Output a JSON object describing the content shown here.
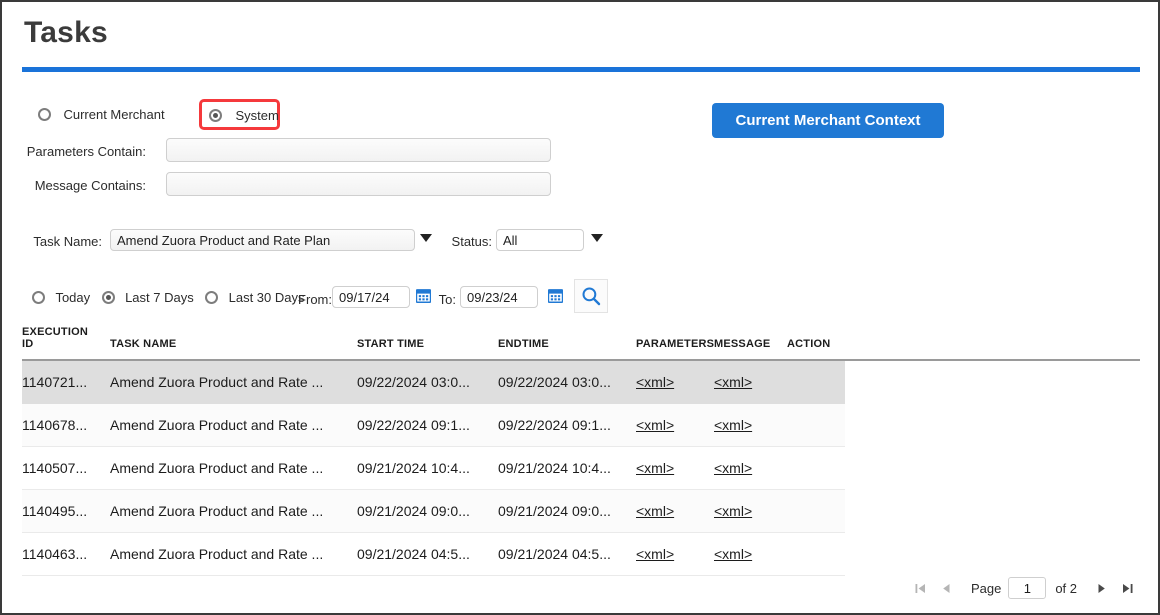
{
  "page": {
    "title": "Tasks"
  },
  "context": {
    "options": [
      {
        "label": "Current Merchant",
        "selected": false
      },
      {
        "label": "System",
        "selected": true,
        "highlighted": true
      }
    ],
    "highlight_color": "#f5393c"
  },
  "filters": {
    "parameters_label": "Parameters Contain:",
    "parameters_value": "",
    "message_label": "Message Contains:",
    "message_value": "",
    "task_name_label": "Task Name:",
    "task_name_value": "Amend Zuora Product and Rate Plan",
    "status_label": "Status:",
    "status_value": "All"
  },
  "date_filter": {
    "options": [
      {
        "label": "Today",
        "selected": false
      },
      {
        "label": "Last 7 Days",
        "selected": true
      },
      {
        "label": "Last 30 Days",
        "selected": false
      }
    ],
    "from_label": "From:",
    "from_value": "09/17/24",
    "to_label": "To:",
    "to_value": "09/23/24",
    "from_calendar_icon": "calendar-icon",
    "to_calendar_icon": "calendar-icon",
    "search_icon": "search-icon"
  },
  "actions": {
    "merchant_context_button": "Current Merchant Context",
    "merchant_context_color": "#2079d4"
  },
  "table": {
    "columns": [
      "EXECUTION ID",
      "TASK NAME",
      "START TIME",
      "ENDTIME",
      "PARAMETERS",
      "MESSAGE",
      "ACTION"
    ],
    "rows": [
      {
        "execution_id": "1140721...",
        "task_name": "Amend Zuora Product and Rate ...",
        "start_time": "09/22/2024 03:0...",
        "end_time": "09/22/2024 03:0...",
        "parameters": "<xml>",
        "message": "<xml>",
        "action": "",
        "selected": true
      },
      {
        "execution_id": "1140678...",
        "task_name": "Amend Zuora Product and Rate ...",
        "start_time": "09/22/2024 09:1...",
        "end_time": "09/22/2024 09:1...",
        "parameters": "<xml>",
        "message": "<xml>",
        "action": "",
        "selected": false
      },
      {
        "execution_id": "1140507...",
        "task_name": "Amend Zuora Product and Rate ...",
        "start_time": "09/21/2024 10:4...",
        "end_time": "09/21/2024 10:4...",
        "parameters": "<xml>",
        "message": "<xml>",
        "action": "",
        "selected": false
      },
      {
        "execution_id": "1140495...",
        "task_name": "Amend Zuora Product and Rate ...",
        "start_time": "09/21/2024 09:0...",
        "end_time": "09/21/2024 09:0...",
        "parameters": "<xml>",
        "message": "<xml>",
        "action": "",
        "selected": false
      },
      {
        "execution_id": "1140463...",
        "task_name": "Amend Zuora Product and Rate ...",
        "start_time": "09/21/2024 04:5...",
        "end_time": "09/21/2024 04:5...",
        "parameters": "<xml>",
        "message": "<xml>",
        "action": "",
        "selected": false
      }
    ]
  },
  "pagination": {
    "first_icon": "first-page-icon",
    "prev_icon": "previous-page-icon",
    "page_word": "Page",
    "page_value": "1",
    "of_text": "of 2",
    "next_icon": "next-page-icon",
    "last_icon": "last-page-icon",
    "first_enabled": false,
    "prev_enabled": false,
    "next_enabled": true,
    "last_enabled": true
  }
}
